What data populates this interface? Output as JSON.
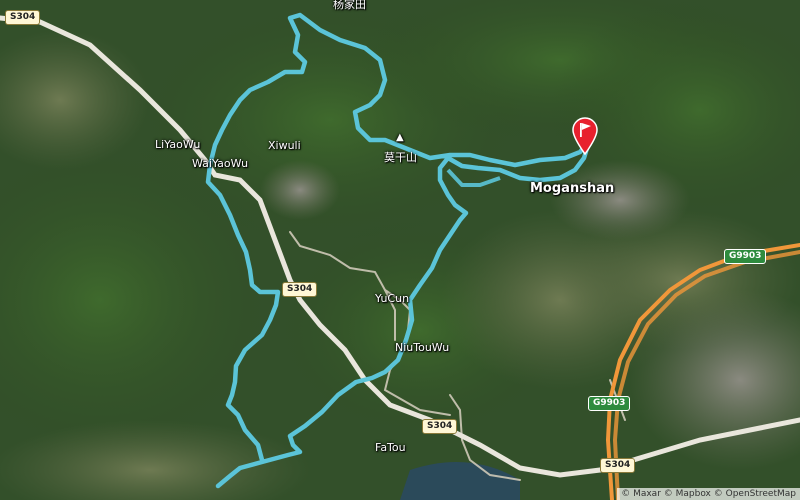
{
  "map": {
    "colors": {
      "route": "#5bc4d8",
      "finish_flag": "#e8212e",
      "expressway": "#f0973a"
    },
    "places": {
      "yangjiatian": "杨家田",
      "liyaowu": "LiYaoWu",
      "waiyaowu": "WaiYaoWu",
      "xiwuli": "Xiwuli",
      "moganshan_peak": "莫干山",
      "moganshan": "Moganshan",
      "yucun": "YuCun",
      "niutouwu": "NiuTouWu",
      "fatou": "FaTou"
    },
    "road_shields": {
      "s304_a": "S304",
      "s304_b": "S304",
      "s304_c": "S304",
      "s304_d": "S304",
      "g9903_a": "G9903",
      "g9903_b": "G9903"
    },
    "attribution": "© Maxar © Mapbox © OpenStreetMap",
    "icons": {
      "finish": "flag-icon",
      "peak": "mountain-peak-icon"
    }
  }
}
